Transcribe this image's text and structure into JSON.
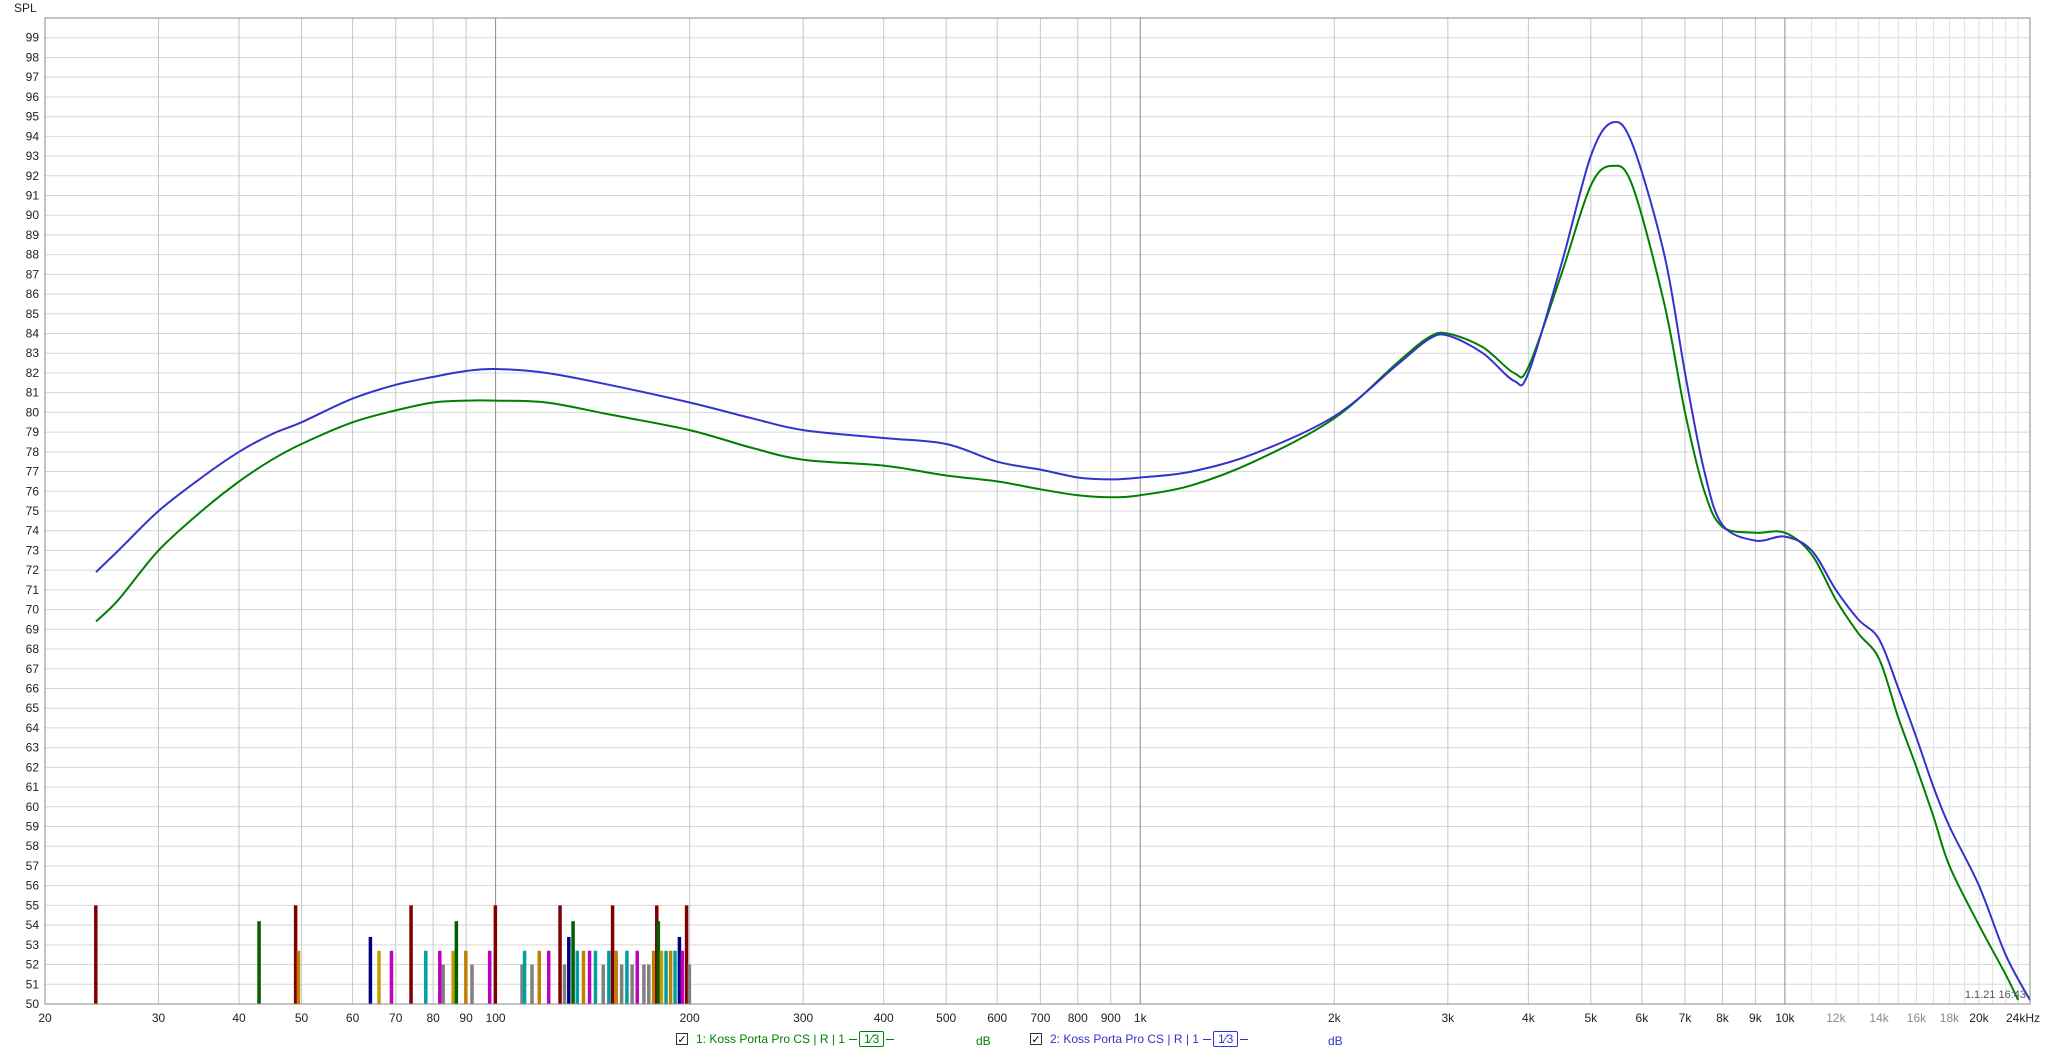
{
  "chart_data": {
    "type": "line",
    "title": "",
    "ylabel": "SPL",
    "xunit_label": "24kHz",
    "xscale": "log",
    "xlim": [
      20,
      24000
    ],
    "ylim": [
      50,
      100
    ],
    "grid": true,
    "y_ticks": [
      50,
      51,
      52,
      53,
      54,
      55,
      56,
      57,
      58,
      59,
      60,
      61,
      62,
      63,
      64,
      65,
      66,
      67,
      68,
      69,
      70,
      71,
      72,
      73,
      74,
      75,
      76,
      77,
      78,
      79,
      80,
      81,
      82,
      83,
      84,
      85,
      86,
      87,
      88,
      89,
      90,
      91,
      92,
      93,
      94,
      95,
      96,
      97,
      98,
      99
    ],
    "x_ticks": [
      {
        "v": 20,
        "label": "20"
      },
      {
        "v": 30,
        "label": "30"
      },
      {
        "v": 40,
        "label": "40"
      },
      {
        "v": 50,
        "label": "50"
      },
      {
        "v": 60,
        "label": "60"
      },
      {
        "v": 70,
        "label": "70"
      },
      {
        "v": 80,
        "label": "80"
      },
      {
        "v": 90,
        "label": "90"
      },
      {
        "v": 100,
        "label": "100"
      },
      {
        "v": 200,
        "label": "200"
      },
      {
        "v": 300,
        "label": "300"
      },
      {
        "v": 400,
        "label": "400"
      },
      {
        "v": 500,
        "label": "500"
      },
      {
        "v": 600,
        "label": "600"
      },
      {
        "v": 700,
        "label": "700"
      },
      {
        "v": 800,
        "label": "800"
      },
      {
        "v": 900,
        "label": "900"
      },
      {
        "v": 1000,
        "label": "1k"
      },
      {
        "v": 2000,
        "label": "2k"
      },
      {
        "v": 3000,
        "label": "3k"
      },
      {
        "v": 4000,
        "label": "4k"
      },
      {
        "v": 5000,
        "label": "5k"
      },
      {
        "v": 6000,
        "label": "6k"
      },
      {
        "v": 7000,
        "label": "7k"
      },
      {
        "v": 8000,
        "label": "8k"
      },
      {
        "v": 9000,
        "label": "9k"
      },
      {
        "v": 10000,
        "label": "10k"
      },
      {
        "v": 12000,
        "label": "12k",
        "light": true
      },
      {
        "v": 14000,
        "label": "14k",
        "light": true
      },
      {
        "v": 16000,
        "label": "16k",
        "light": true
      },
      {
        "v": 18000,
        "label": "18k",
        "light": true
      },
      {
        "v": 20000,
        "label": "20k"
      }
    ],
    "series": [
      {
        "name": "1: Koss Porta Pro CS | R | 1",
        "color": "#008000",
        "points": [
          [
            24,
            69.4
          ],
          [
            26,
            70.5
          ],
          [
            30,
            73.0
          ],
          [
            35,
            75.0
          ],
          [
            40,
            76.5
          ],
          [
            45,
            77.6
          ],
          [
            50,
            78.4
          ],
          [
            60,
            79.5
          ],
          [
            70,
            80.1
          ],
          [
            80,
            80.5
          ],
          [
            90,
            80.6
          ],
          [
            100,
            80.6
          ],
          [
            120,
            80.5
          ],
          [
            150,
            79.9
          ],
          [
            200,
            79.1
          ],
          [
            250,
            78.2
          ],
          [
            300,
            77.6
          ],
          [
            400,
            77.3
          ],
          [
            500,
            76.8
          ],
          [
            600,
            76.5
          ],
          [
            700,
            76.1
          ],
          [
            800,
            75.8
          ],
          [
            900,
            75.7
          ],
          [
            1000,
            75.8
          ],
          [
            1200,
            76.3
          ],
          [
            1500,
            77.5
          ],
          [
            2000,
            79.7
          ],
          [
            2500,
            82.5
          ],
          [
            2800,
            83.8
          ],
          [
            3000,
            84.0
          ],
          [
            3400,
            83.3
          ],
          [
            3800,
            82.0
          ],
          [
            4000,
            82.3
          ],
          [
            4500,
            87.0
          ],
          [
            5000,
            91.5
          ],
          [
            5400,
            92.5
          ],
          [
            5800,
            91.5
          ],
          [
            6500,
            85.5
          ],
          [
            7000,
            80.0
          ],
          [
            7500,
            76.0
          ],
          [
            8000,
            74.2
          ],
          [
            9000,
            73.9
          ],
          [
            10000,
            73.9
          ],
          [
            11000,
            72.8
          ],
          [
            12000,
            70.5
          ],
          [
            13000,
            68.8
          ],
          [
            14000,
            67.5
          ],
          [
            15000,
            64.5
          ],
          [
            16000,
            62.0
          ],
          [
            17000,
            59.5
          ],
          [
            18000,
            57.0
          ],
          [
            20000,
            54.0
          ],
          [
            22000,
            51.5
          ],
          [
            23000,
            50.2
          ]
        ]
      },
      {
        "name": "2: Koss Porta Pro CS | R | 1",
        "color": "#3333cc",
        "points": [
          [
            24,
            71.9
          ],
          [
            26,
            73.0
          ],
          [
            30,
            75.0
          ],
          [
            35,
            76.7
          ],
          [
            40,
            78.0
          ],
          [
            45,
            78.9
          ],
          [
            50,
            79.5
          ],
          [
            60,
            80.7
          ],
          [
            70,
            81.4
          ],
          [
            80,
            81.8
          ],
          [
            90,
            82.1
          ],
          [
            100,
            82.2
          ],
          [
            120,
            82.0
          ],
          [
            150,
            81.4
          ],
          [
            200,
            80.5
          ],
          [
            250,
            79.7
          ],
          [
            300,
            79.1
          ],
          [
            400,
            78.7
          ],
          [
            500,
            78.4
          ],
          [
            600,
            77.5
          ],
          [
            700,
            77.1
          ],
          [
            800,
            76.7
          ],
          [
            900,
            76.6
          ],
          [
            1000,
            76.7
          ],
          [
            1200,
            77.0
          ],
          [
            1500,
            77.9
          ],
          [
            2000,
            79.8
          ],
          [
            2500,
            82.4
          ],
          [
            2800,
            83.7
          ],
          [
            3000,
            83.9
          ],
          [
            3400,
            83.0
          ],
          [
            3800,
            81.6
          ],
          [
            4000,
            82.0
          ],
          [
            4500,
            87.5
          ],
          [
            5000,
            93.0
          ],
          [
            5400,
            94.7
          ],
          [
            5800,
            93.6
          ],
          [
            6500,
            88.0
          ],
          [
            7000,
            82.0
          ],
          [
            7500,
            77.0
          ],
          [
            8000,
            74.3
          ],
          [
            9000,
            73.5
          ],
          [
            10000,
            73.7
          ],
          [
            11000,
            73.0
          ],
          [
            12000,
            71.0
          ],
          [
            13000,
            69.5
          ],
          [
            14000,
            68.5
          ],
          [
            15000,
            66.0
          ],
          [
            16000,
            63.5
          ],
          [
            17000,
            61.0
          ],
          [
            18000,
            59.0
          ],
          [
            20000,
            56.0
          ],
          [
            22000,
            52.5
          ],
          [
            24000,
            50.2
          ]
        ]
      }
    ],
    "peaks": [
      {
        "f": 24,
        "level": 55,
        "color": "#800000"
      },
      {
        "f": 43,
        "level": 54.2,
        "color": "#006000"
      },
      {
        "f": 49,
        "level": 55,
        "color": "#800000"
      },
      {
        "f": 49.5,
        "level": 52.7,
        "color": "#c08000"
      },
      {
        "f": 64,
        "level": 53.4,
        "color": "#000080"
      },
      {
        "f": 66,
        "level": 52.7,
        "color": "#c0a000"
      },
      {
        "f": 69,
        "level": 52.7,
        "color": "#c000c0"
      },
      {
        "f": 74,
        "level": 55,
        "color": "#800000"
      },
      {
        "f": 78,
        "level": 52.7,
        "color": "#00a0a0"
      },
      {
        "f": 82,
        "level": 52.7,
        "color": "#c000c0"
      },
      {
        "f": 83,
        "level": 52,
        "color": "#808080"
      },
      {
        "f": 86,
        "level": 52.7,
        "color": "#c0a000"
      },
      {
        "f": 87,
        "level": 54.2,
        "color": "#006000"
      },
      {
        "f": 90,
        "level": 52.7,
        "color": "#c08000"
      },
      {
        "f": 92,
        "level": 52,
        "color": "#808080"
      },
      {
        "f": 98,
        "level": 52.7,
        "color": "#c000c0"
      },
      {
        "f": 100,
        "level": 55,
        "color": "#800000"
      },
      {
        "f": 110,
        "level": 52,
        "color": "#808080"
      },
      {
        "f": 111,
        "level": 52.7,
        "color": "#00a0a0"
      },
      {
        "f": 114,
        "level": 52,
        "color": "#808080"
      },
      {
        "f": 117,
        "level": 52.7,
        "color": "#c08000"
      },
      {
        "f": 121,
        "level": 52.7,
        "color": "#c000c0"
      },
      {
        "f": 126,
        "level": 55,
        "color": "#800000"
      },
      {
        "f": 128,
        "level": 52,
        "color": "#808080"
      },
      {
        "f": 130,
        "level": 53.4,
        "color": "#000080"
      },
      {
        "f": 132,
        "level": 54.2,
        "color": "#006000"
      },
      {
        "f": 134,
        "level": 52.7,
        "color": "#00a0a0"
      },
      {
        "f": 137,
        "level": 52.7,
        "color": "#c08000"
      },
      {
        "f": 140,
        "level": 52.7,
        "color": "#c000c0"
      },
      {
        "f": 143,
        "level": 52.7,
        "color": "#00a0a0"
      },
      {
        "f": 147,
        "level": 52,
        "color": "#808080"
      },
      {
        "f": 150,
        "level": 52.7,
        "color": "#00a0a0"
      },
      {
        "f": 152,
        "level": 55,
        "color": "#800000"
      },
      {
        "f": 154,
        "level": 52.7,
        "color": "#c08000"
      },
      {
        "f": 157,
        "level": 52,
        "color": "#808080"
      },
      {
        "f": 160,
        "level": 52.7,
        "color": "#00a0a0"
      },
      {
        "f": 163,
        "level": 52,
        "color": "#808080"
      },
      {
        "f": 166,
        "level": 52.7,
        "color": "#c000c0"
      },
      {
        "f": 170,
        "level": 52,
        "color": "#808080"
      },
      {
        "f": 173,
        "level": 52,
        "color": "#808080"
      },
      {
        "f": 176,
        "level": 52.7,
        "color": "#c08000"
      },
      {
        "f": 178,
        "level": 55,
        "color": "#800000"
      },
      {
        "f": 179,
        "level": 54.2,
        "color": "#006000"
      },
      {
        "f": 181,
        "level": 52.7,
        "color": "#c0a000"
      },
      {
        "f": 184,
        "level": 52.7,
        "color": "#00a0a0"
      },
      {
        "f": 187,
        "level": 52.7,
        "color": "#c08000"
      },
      {
        "f": 190,
        "level": 52.7,
        "color": "#00a0a0"
      },
      {
        "f": 193,
        "level": 53.4,
        "color": "#000080"
      },
      {
        "f": 195,
        "level": 52.7,
        "color": "#c000c0"
      },
      {
        "f": 198,
        "level": 55,
        "color": "#800000"
      },
      {
        "f": 200,
        "level": 52,
        "color": "#808080"
      }
    ],
    "stamp": "1.1.21 16:43"
  },
  "legend": [
    {
      "checked": "✓",
      "label": "1: Koss Porta Pro CS | R | 1",
      "smoothing": "1⁄3",
      "unit": "dB",
      "color": "#008000"
    },
    {
      "checked": "✓",
      "label": "2: Koss Porta Pro CS | R | 1",
      "smoothing": "1⁄3",
      "unit": "dB",
      "color": "#3333cc"
    }
  ]
}
